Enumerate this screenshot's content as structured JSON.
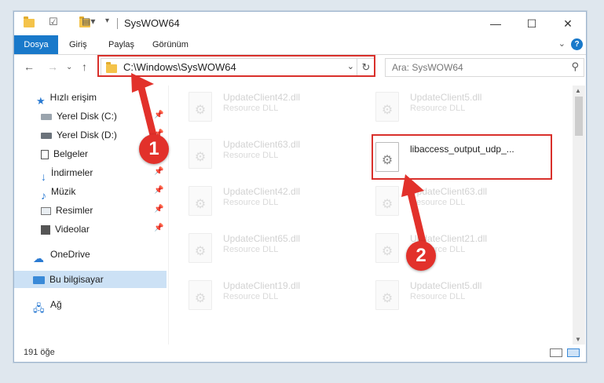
{
  "window": {
    "title": "SysWOW64",
    "controls": {
      "minimize": "—",
      "maximize": "☐",
      "close": "✕"
    }
  },
  "ribbon": {
    "tabs": [
      {
        "label": "Dosya",
        "active": true
      },
      {
        "label": "Giriş"
      },
      {
        "label": "Paylaş"
      },
      {
        "label": "Görünüm"
      }
    ],
    "help": "?"
  },
  "address": {
    "path": "C:\\Windows\\SysWOW64",
    "search_placeholder": "Ara: SysWOW64"
  },
  "sidebar": {
    "quick_access": "Hızlı erişim",
    "items": [
      {
        "label": "Yerel Disk (C:)",
        "icon": "drive-icon",
        "pinned": true
      },
      {
        "label": "Yerel Disk (D:)",
        "icon": "drive-icon",
        "pinned": true
      },
      {
        "label": "Belgeler",
        "icon": "documents-icon",
        "pinned": true
      },
      {
        "label": "İndirmeler",
        "icon": "download-icon",
        "pinned": true
      },
      {
        "label": "Müzik",
        "icon": "music-icon",
        "pinned": true
      },
      {
        "label": "Resimler",
        "icon": "pictures-icon",
        "pinned": true
      },
      {
        "label": "Videolar",
        "icon": "videos-icon",
        "pinned": true
      }
    ],
    "onedrive": "OneDrive",
    "this_pc": "Bu bilgisayar",
    "network": "Ağ"
  },
  "files": {
    "left": [
      {
        "name": "UpdateClient42.dll",
        "type": "Resource DLL"
      },
      {
        "name": "UpdateClient63.dll",
        "type": "Resource DLL"
      },
      {
        "name": "UpdateClient42.dll",
        "type": "Resource DLL"
      },
      {
        "name": "UpdateClient65.dll",
        "type": "Resource DLL"
      },
      {
        "name": "UpdateClient19.dll",
        "type": "Resource DLL"
      }
    ],
    "right": [
      {
        "name": "UpdateClient5.dll",
        "type": "Resource DLL"
      },
      {
        "name": "libaccess_output_udp_...",
        "type": ""
      },
      {
        "name": "UpdateClient63.dll",
        "type": "Resource DLL"
      },
      {
        "name": "UpdateClient21.dll",
        "type": "Resource DLL"
      },
      {
        "name": "UpdateClient5.dll",
        "type": "Resource DLL"
      }
    ]
  },
  "status": {
    "count": "191 öğe"
  },
  "annotations": {
    "step1": "1",
    "step2": "2",
    "color": "#e2312b"
  }
}
